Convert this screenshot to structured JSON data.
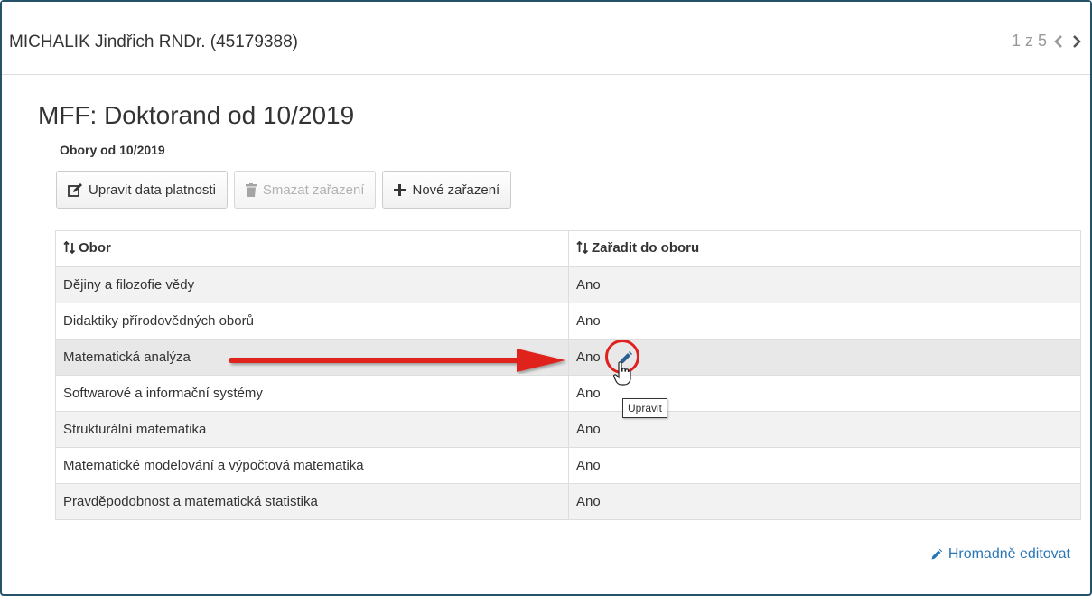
{
  "header": {
    "person": "MICHALIK Jindřich RNDr. (45179388)",
    "pager_text": "1 z 5",
    "prev_icon": "chevron-left-icon",
    "next_icon": "chevron-right-icon"
  },
  "section": {
    "title": "MFF: Doktorand od 10/2019",
    "subtitle": "Obory od 10/2019"
  },
  "toolbar": {
    "edit_dates_label": "Upravit data platnosti",
    "delete_label": "Smazat zařazení",
    "new_label": "Nové zařazení"
  },
  "table": {
    "headers": [
      "Obor",
      "Zařadit do oboru"
    ],
    "rows": [
      {
        "obor": "Dějiny a filozofie vědy",
        "zaradit": "Ano"
      },
      {
        "obor": "Didaktiky přírodovědných oborů",
        "zaradit": "Ano"
      },
      {
        "obor": "Matematická analýza",
        "zaradit": "Ano"
      },
      {
        "obor": "Softwarové a informační systémy",
        "zaradit": "Ano"
      },
      {
        "obor": "Strukturální matematika",
        "zaradit": "Ano"
      },
      {
        "obor": "Matematické modelování a výpočtová matematika",
        "zaradit": "Ano"
      },
      {
        "obor": "Pravděpodobnost a matematická statistika",
        "zaradit": "Ano"
      }
    ]
  },
  "tooltip": "Upravit",
  "bulk_edit_label": "Hromadně editovat",
  "colors": {
    "accent_link": "#2a76b5",
    "annotation_red": "#e0201e",
    "frame_border": "#245269"
  }
}
